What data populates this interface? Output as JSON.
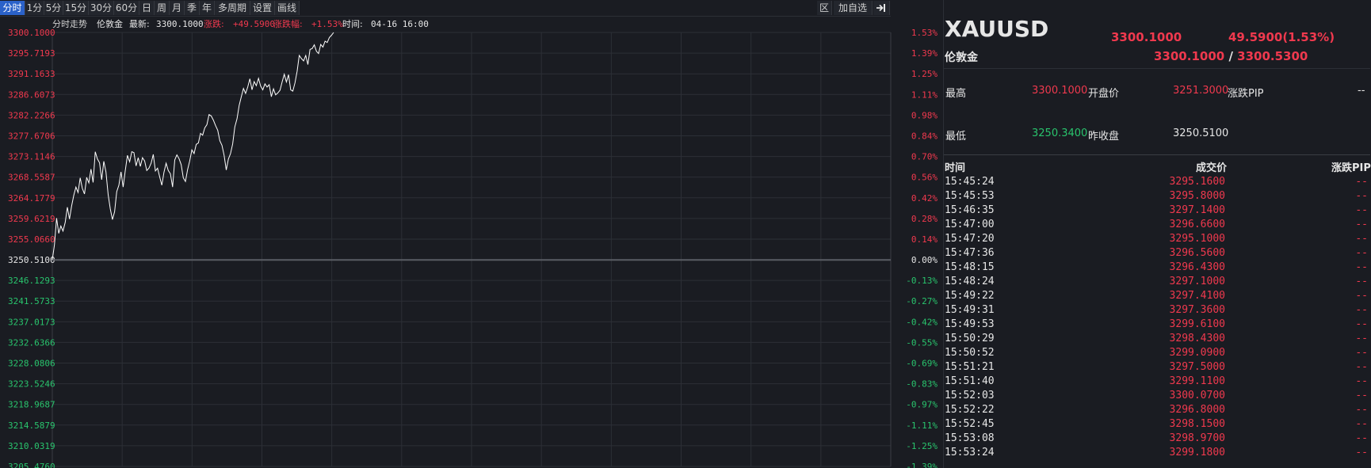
{
  "toolbar": {
    "periods": [
      "分时",
      "1分",
      "5分",
      "15分",
      "30分",
      "60分",
      "日",
      "周",
      "月",
      "季",
      "年",
      "多周期",
      "设置",
      "画线"
    ],
    "active_index": 0,
    "region_btn": "区",
    "add_watch_btn": "加自选"
  },
  "chart_info": {
    "mode_label": "分时走势",
    "name": "伦敦金",
    "latest_label": "最新:",
    "latest_value": "3300.1000",
    "change_label": "涨跌:",
    "change_value": "+49.5900",
    "change_pct_label": "涨跌幅:",
    "change_pct_value": "+1.53%",
    "time_label": "时间:",
    "time_value": "04-16 16:00"
  },
  "colors": {
    "up": "#f0394e",
    "down": "#29c46d",
    "line": "#ffffff",
    "grid": "#2c2f36",
    "background": "#1a1c22"
  },
  "chart_data": {
    "type": "line",
    "base_price": 3250.51,
    "y_ticks_left": [
      "3300.1000",
      "3295.7193",
      "3291.1633",
      "3286.6073",
      "3282.2266",
      "3277.6706",
      "3273.1146",
      "3268.5587",
      "3264.1779",
      "3259.6219",
      "3255.0660",
      "3250.5100",
      "3246.1293",
      "3241.5733",
      "3237.0173",
      "3232.6366",
      "3228.0806",
      "3223.5246",
      "3218.9687",
      "3214.5879",
      "3210.0319",
      "3205.4760"
    ],
    "y_ticks_right": [
      "1.53%",
      "1.39%",
      "1.25%",
      "1.11%",
      "0.98%",
      "0.84%",
      "0.70%",
      "0.56%",
      "0.42%",
      "0.28%",
      "0.14%",
      "0.00%",
      "-0.13%",
      "-0.27%",
      "-0.42%",
      "-0.55%",
      "-0.69%",
      "-0.83%",
      "-0.97%",
      "-1.11%",
      "-1.25%",
      "-1.39%"
    ],
    "ylim": [
      3205.476,
      3300.1
    ],
    "x_total_points": 1440,
    "series": [
      {
        "values": [
          3250.51,
          3253.8,
          3259.6,
          3256.3,
          3257.9,
          3256.8,
          3258.7,
          3262.0,
          3259.4,
          3262.3,
          3264.6,
          3266.4,
          3265.2,
          3268.4,
          3266.1,
          3264.9,
          3268.5,
          3267.3,
          3270.3,
          3267.4,
          3274.1,
          3272.5,
          3271.7,
          3268.0,
          3272.0,
          3269.7,
          3264.7,
          3261.6,
          3259.3,
          3261.0,
          3265.4,
          3266.8,
          3269.7,
          3266.4,
          3270.0,
          3273.3,
          3271.9,
          3274.1,
          3273.9,
          3271.0,
          3272.8,
          3270.9,
          3272.8,
          3272.1,
          3270.0,
          3270.5,
          3271.6,
          3273.5,
          3269.9,
          3270.5,
          3268.6,
          3266.8,
          3269.6,
          3271.6,
          3270.0,
          3269.3,
          3266.4,
          3272.3,
          3273.4,
          3272.6,
          3271.3,
          3268.4,
          3267.6,
          3270.2,
          3272.1,
          3274.5,
          3273.7,
          3275.7,
          3276.0,
          3278.1,
          3277.7,
          3279.3,
          3280.0,
          3282.2,
          3281.9,
          3281.0,
          3279.8,
          3278.8,
          3276.5,
          3275.5,
          3273.3,
          3270.1,
          3272.5,
          3273.7,
          3275.8,
          3279.5,
          3281.3,
          3284.2,
          3286.1,
          3287.9,
          3286.8,
          3288.2,
          3290.0,
          3287.6,
          3289.4,
          3288.5,
          3290.1,
          3288.4,
          3287.6,
          3288.9,
          3288.2,
          3288.7,
          3286.1,
          3287.8,
          3286.5,
          3286.9,
          3287.5,
          3289.3,
          3291.0,
          3289.3,
          3290.9,
          3287.6,
          3287.3,
          3289.1,
          3291.6,
          3295.1,
          3294.4,
          3293.9,
          3295.1,
          3293.1,
          3296.4,
          3296.6,
          3297.4,
          3296.0,
          3295.5,
          3297.5,
          3296.9,
          3298.2,
          3297.9,
          3299.0,
          3299.5,
          3300.1
        ]
      }
    ]
  },
  "panel": {
    "symbol": "XAUUSD",
    "price": "3300.1000",
    "change": "49.5900(1.53%)",
    "name": "伦敦金",
    "bid": "3300.1000",
    "separator": "/",
    "ask": "3300.5300",
    "stats": {
      "high_label": "最高",
      "high_value": "3300.1000",
      "open_label": "开盘价",
      "open_value": "3251.3000",
      "pip_label": "涨跌PIP",
      "pip_value": "--",
      "low_label": "最低",
      "low_value": "3250.3400",
      "prev_close_label": "昨收盘",
      "prev_close_value": "3250.5100"
    },
    "trade_headers": {
      "time": "时间",
      "price": "成交价",
      "pip": "涨跌PIP"
    },
    "trades": [
      {
        "time": "15:45:24",
        "price": "3295.1600",
        "pip": "--"
      },
      {
        "time": "15:45:53",
        "price": "3295.8000",
        "pip": "--"
      },
      {
        "time": "15:46:35",
        "price": "3297.1400",
        "pip": "--"
      },
      {
        "time": "15:47:00",
        "price": "3296.6600",
        "pip": "--"
      },
      {
        "time": "15:47:20",
        "price": "3295.1000",
        "pip": "--"
      },
      {
        "time": "15:47:36",
        "price": "3296.5600",
        "pip": "--"
      },
      {
        "time": "15:48:15",
        "price": "3296.4300",
        "pip": "--"
      },
      {
        "time": "15:48:24",
        "price": "3297.1000",
        "pip": "--"
      },
      {
        "time": "15:49:22",
        "price": "3297.4100",
        "pip": "--"
      },
      {
        "time": "15:49:31",
        "price": "3297.3600",
        "pip": "--"
      },
      {
        "time": "15:49:53",
        "price": "3299.6100",
        "pip": "--"
      },
      {
        "time": "15:50:29",
        "price": "3298.4300",
        "pip": "--"
      },
      {
        "time": "15:50:52",
        "price": "3299.0900",
        "pip": "--"
      },
      {
        "time": "15:51:21",
        "price": "3297.5000",
        "pip": "--"
      },
      {
        "time": "15:51:40",
        "price": "3299.1100",
        "pip": "--"
      },
      {
        "time": "15:52:03",
        "price": "3300.0700",
        "pip": "--"
      },
      {
        "time": "15:52:22",
        "price": "3296.8000",
        "pip": "--"
      },
      {
        "time": "15:52:45",
        "price": "3298.1500",
        "pip": "--"
      },
      {
        "time": "15:53:08",
        "price": "3298.9700",
        "pip": "--"
      },
      {
        "time": "15:53:24",
        "price": "3299.1800",
        "pip": "--"
      }
    ]
  }
}
